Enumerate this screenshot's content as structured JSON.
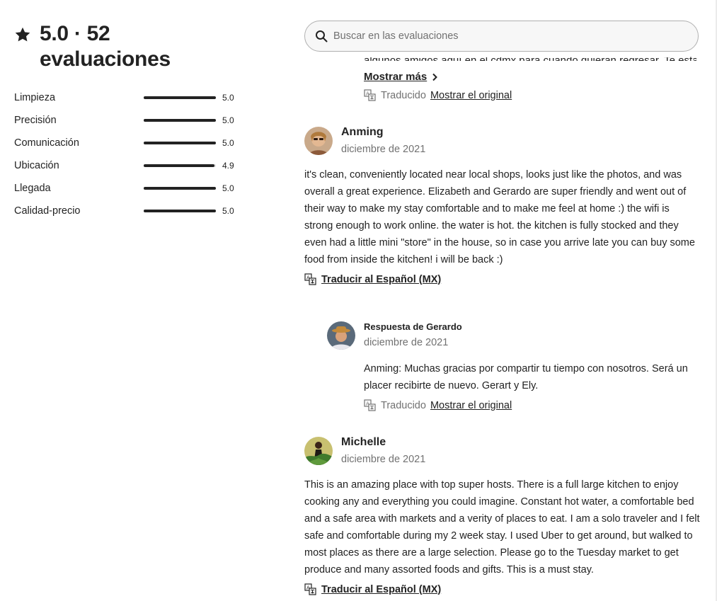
{
  "summary": {
    "title_line1": "5.0 · 52",
    "title_line2": "evaluaciones",
    "categories": [
      {
        "label": "Limpieza",
        "value": "5.0",
        "fraction": 1.0
      },
      {
        "label": "Precisión",
        "value": "5.0",
        "fraction": 1.0
      },
      {
        "label": "Comunicación",
        "value": "5.0",
        "fraction": 1.0
      },
      {
        "label": "Ubicación",
        "value": "4.9",
        "fraction": 0.98
      },
      {
        "label": "Llegada",
        "value": "5.0",
        "fraction": 1.0
      },
      {
        "label": "Calidad-precio",
        "value": "5.0",
        "fraction": 1.0
      }
    ]
  },
  "search": {
    "placeholder": "Buscar en las evaluaciones"
  },
  "previous_review": {
    "cut_text": "algunos amigos aquí en el cdmx para cuando quieran regresar. Te estam…",
    "show_more": "Mostrar más",
    "translated_label": "Traducido",
    "show_original": "Mostrar el original"
  },
  "reviews": [
    {
      "name": "Anming",
      "date": "diciembre de 2021",
      "lines": [
        "it's clean, conveniently located near local shops, looks just like the photos, and was",
        "overall a great experience. Elizabeth and Gerardo are super friendly and went out of",
        "their way to make my stay comfortable and to make me feel at home :) the wifi is",
        "strong enough to work online. the water is hot. the kitchen is fully stocked and they",
        "even had a little mini \"store\" in the house, so in case you arrive late you can buy some",
        "food from inside the kitchen! i will be back :)"
      ],
      "translate": "Traducir al Español (MX)",
      "response": {
        "title": "Respuesta de Gerardo",
        "date": "diciembre de 2021",
        "lines": [
          "Anming: Muchas gracias por compartir tu tiempo con nosotros. Será un",
          "placer recibirte de nuevo. Gerart y Ely."
        ],
        "translated_label": "Traducido",
        "show_original": "Mostrar el original"
      }
    },
    {
      "name": "Michelle",
      "date": "diciembre de 2021",
      "lines": [
        "This is an amazing place with top super hosts. There is a full large kitchen to enjoy",
        "cooking any and everything you could imagine. Constant hot water, a comfortable bed",
        "and a safe area with markets and a verity of places to eat. I am a solo traveler and I felt",
        "safe and comfortable during my 2 week stay. I used Uber to get around, but walked to",
        "most places as there are a large selection. Please go to the Tuesday market to get",
        "produce and many assorted foods and gifts. This is a must stay."
      ],
      "translate": "Traducir al Español (MX)"
    }
  ]
}
